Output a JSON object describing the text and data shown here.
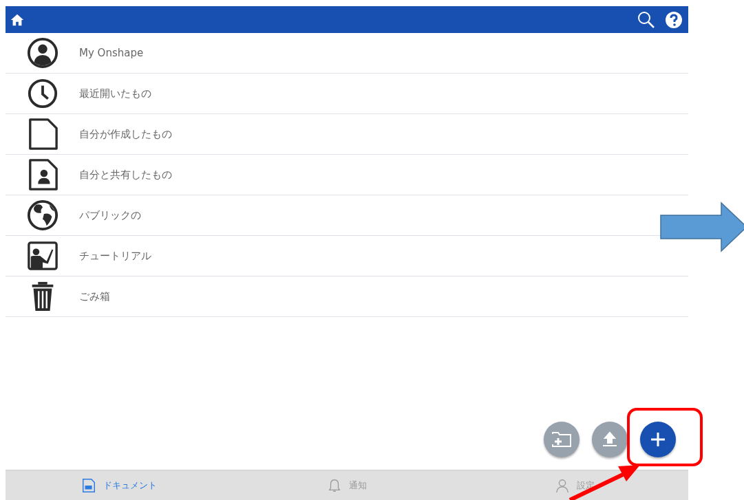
{
  "menu_items": [
    {
      "label": "My Onshape",
      "kind": "profile"
    },
    {
      "label": "最近開いたもの",
      "kind": "recent"
    },
    {
      "label": "自分が作成したもの",
      "kind": "created"
    },
    {
      "label": "自分と共有したもの",
      "kind": "shared"
    },
    {
      "label": "パブリックの",
      "kind": "public"
    },
    {
      "label": "チュートリアル",
      "kind": "tutorial"
    },
    {
      "label": "ごみ箱",
      "kind": "trash"
    }
  ],
  "tabs": [
    {
      "label": "ドキュメント",
      "kind": "documents",
      "selected": true
    },
    {
      "label": "通知",
      "kind": "notifications",
      "selected": false
    },
    {
      "label": "設定",
      "kind": "settings",
      "selected": false
    }
  ]
}
